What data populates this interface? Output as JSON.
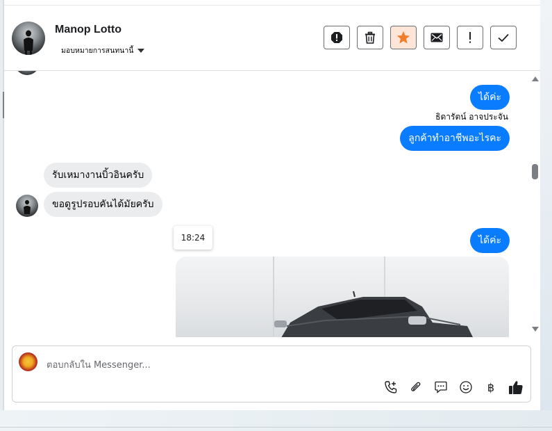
{
  "header": {
    "contact_name": "Manop Lotto",
    "assign_label": "มอบหมายการสนทนานี้",
    "actions": [
      {
        "name": "spam",
        "icon": "octagon-exclamation-icon"
      },
      {
        "name": "delete",
        "icon": "trash-icon"
      },
      {
        "name": "star",
        "icon": "star-icon",
        "active_color": "#f07d29"
      },
      {
        "name": "mark-unread",
        "icon": "envelope-icon"
      },
      {
        "name": "follow-up",
        "icon": "exclamation-icon"
      },
      {
        "name": "done",
        "icon": "check-icon"
      }
    ]
  },
  "messages": [
    {
      "direction": "out",
      "text": "ได้ค่ะ"
    },
    {
      "direction": "out",
      "sender": "ธิดารัตน์ อาจประจัน",
      "text": "ลูกค้าทำอาชีพอะไรคะ"
    },
    {
      "direction": "in",
      "text": "รับเหมางานบิ้วอินครับ"
    },
    {
      "direction": "in",
      "text": "ขอดูรูปรอบคันได้มัยครับ"
    },
    {
      "direction": "out",
      "text": "ได้ค่ะ"
    }
  ],
  "timestamp_chip": "18:24",
  "composer": {
    "placeholder": "ตอบกลับใน Messenger...",
    "currency_symbol": "฿",
    "tools": [
      "phone-plus-icon",
      "paperclip-icon",
      "chat-bubble-icon",
      "smiley-icon",
      "baht-icon",
      "thumbs-up-icon"
    ]
  },
  "colors": {
    "outgoing_bubble": "#0a7cff",
    "incoming_bubble": "#eaecee",
    "star_accent": "#f07d29"
  }
}
